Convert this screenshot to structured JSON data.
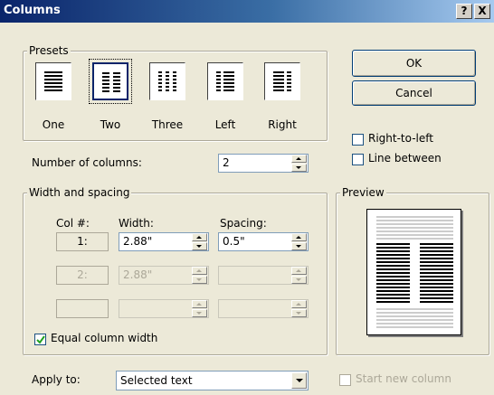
{
  "dialog": {
    "title": "Columns",
    "help_button": "?",
    "close_button": "X"
  },
  "presets": {
    "group_label": "Presets",
    "items": [
      {
        "label": "One",
        "icon": "one-column-icon"
      },
      {
        "label": "Two",
        "icon": "two-column-icon",
        "selected": true
      },
      {
        "label": "Three",
        "icon": "three-column-icon"
      },
      {
        "label": "Left",
        "icon": "left-column-icon"
      },
      {
        "label": "Right",
        "icon": "right-column-icon"
      }
    ]
  },
  "buttons": {
    "ok": "OK",
    "cancel": "Cancel"
  },
  "options": {
    "right_to_left": {
      "label": "Right-to-left",
      "checked": false
    },
    "line_between": {
      "label": "Line between",
      "checked": false
    }
  },
  "number_of_columns": {
    "label": "Number of columns:",
    "value": "2"
  },
  "width_spacing": {
    "group_label": "Width and spacing",
    "col_header": "Col #:",
    "width_header": "Width:",
    "spacing_header": "Spacing:",
    "rows": [
      {
        "col": "1:",
        "width": "2.88\"",
        "spacing": "0.5\"",
        "enabled": true
      },
      {
        "col": "2:",
        "width": "2.88\"",
        "spacing": "",
        "enabled": false
      },
      {
        "col": "",
        "width": "",
        "spacing": "",
        "enabled": false
      }
    ],
    "equal_width": {
      "label": "Equal column width",
      "checked": true
    }
  },
  "preview": {
    "group_label": "Preview"
  },
  "apply_to": {
    "label": "Apply to:",
    "value": "Selected text"
  },
  "start_new_column": {
    "label": "Start new column",
    "checked": false,
    "enabled": false
  },
  "colors": {
    "title_start": "#0a246a",
    "title_end": "#a6caf0",
    "dialog_bg": "#ece9d8",
    "disabled_text": "#aca899"
  }
}
